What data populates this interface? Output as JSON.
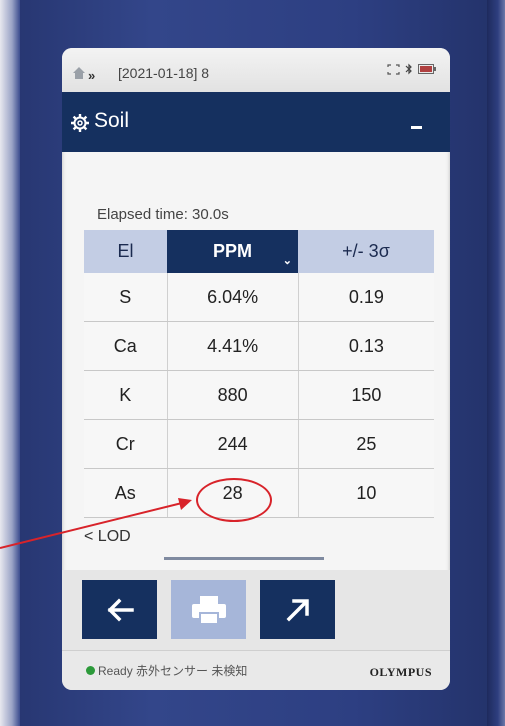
{
  "breadcrumb": {
    "chevrons": "»",
    "text": "[2021-01-18] 8"
  },
  "title": "Soil",
  "elapsed": "Elapsed time: 30.0s",
  "table": {
    "headers": [
      "El",
      "PPM",
      "+/- 3σ"
    ],
    "rows": [
      {
        "el": "S",
        "ppm": "6.04%",
        "sigma": "0.19"
      },
      {
        "el": "Ca",
        "ppm": "4.41%",
        "sigma": "0.13"
      },
      {
        "el": "K",
        "ppm": "880",
        "sigma": "150"
      },
      {
        "el": "Cr",
        "ppm": "244",
        "sigma": "25"
      },
      {
        "el": "As",
        "ppm": "28",
        "sigma": "10"
      }
    ]
  },
  "lod": "< LOD",
  "footer": {
    "status": "Ready 赤外センサー 未検知",
    "brand": "OLYMPUS"
  },
  "icons": [
    "home-icon",
    "chevron-right-icon",
    "screen-icon",
    "bluetooth-icon",
    "battery-icon",
    "gear-icon",
    "minimize-icon",
    "sort-icon",
    "back-arrow-icon",
    "printer-icon",
    "export-arrow-icon"
  ],
  "colors": {
    "header_dark": "#15305f",
    "header_light": "#c3cde4",
    "annotation": "#d8232a",
    "ready": "#2c9a3a"
  }
}
